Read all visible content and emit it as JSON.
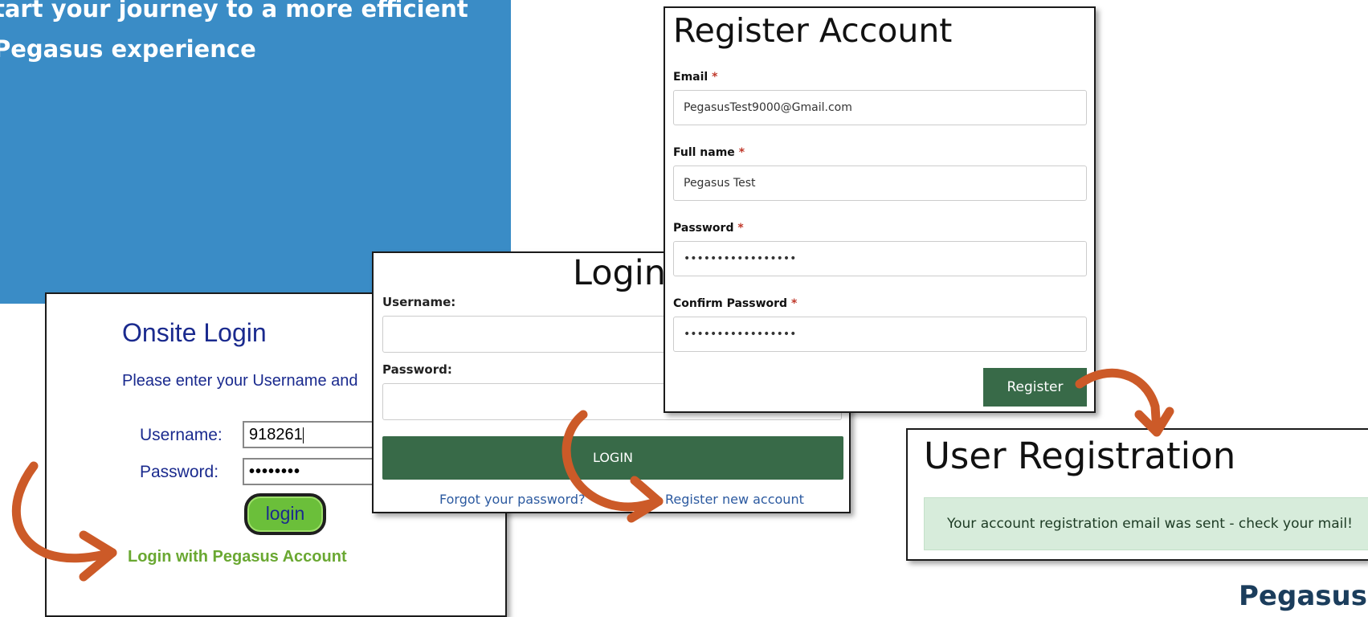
{
  "hero": {
    "line1": "tart your journey to a more efficient",
    "line2": "Pegasus experience"
  },
  "onsite_login": {
    "title": "Onsite Login",
    "prompt": "Please enter your Username and",
    "username_label": "Username:",
    "username_value": "918261",
    "password_label": "Password:",
    "password_value": "••••••••",
    "login_button": "login",
    "pegasus_link": "Login with Pegasus Account"
  },
  "login": {
    "title": "Login",
    "username_label": "Username:",
    "password_label": "Password:",
    "login_button": "LOGIN",
    "forgot_link": "Forgot your password?",
    "register_link": "Register new account"
  },
  "register": {
    "title": "Register Account",
    "email_label": "Email",
    "email_value": "PegasusTest9000@Gmail.com",
    "fullname_label": "Full name",
    "fullname_value": "Pegasus Test",
    "password_label": "Password",
    "password_value": "•••••••••••••••••",
    "confirm_label": "Confirm Password",
    "confirm_value": "•••••••••••••••••",
    "required_marker": "*",
    "register_button": "Register"
  },
  "user_registration": {
    "title": "User Registration",
    "message": "Your account registration email was sent - check your mail!"
  },
  "brand_fragment": "Pegasus",
  "colors": {
    "hero_blue": "#3a8cc6",
    "button_green": "#386a48",
    "arrow_orange": "#cc5a28",
    "onsite_text": "#1a2a8e",
    "link_blue": "#2c5aa0",
    "success_bg": "#d7ecdb"
  }
}
